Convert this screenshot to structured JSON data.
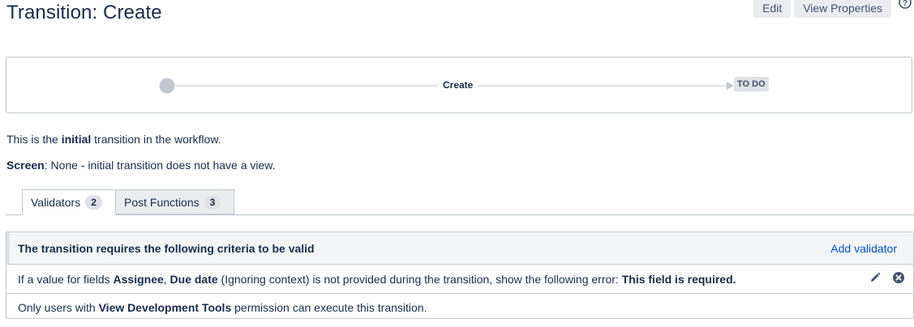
{
  "page": {
    "title": "Transition: Create"
  },
  "toolbar": {
    "edit_label": "Edit",
    "view_properties_label": "View Properties",
    "help_icon": "help-icon"
  },
  "diagram": {
    "transition_name": "Create",
    "target_status": "TO DO"
  },
  "info": {
    "line1": {
      "prefix": "This is the ",
      "bold": "initial",
      "suffix": " transition in the workflow."
    },
    "line2": {
      "label": "Screen",
      "text": ": None - initial transition does not have a view."
    }
  },
  "tabs": [
    {
      "label": "Validators",
      "count": "2",
      "active": true
    },
    {
      "label": "Post Functions",
      "count": "3",
      "active": false
    }
  ],
  "validators": {
    "header": "The transition requires the following criteria to be valid",
    "add_label": "Add validator",
    "rows": [
      {
        "t1": "If a value for fields ",
        "b1": "Assignee",
        "t2": ", ",
        "b2": "Due date",
        "t3": " (Ignoring context) is not provided during the transition, show the following error: ",
        "b3": "This field is required."
      },
      {
        "t1": "Only users with ",
        "b1": "View Development Tools",
        "t2": " permission can execute this transition."
      }
    ]
  },
  "colors": {
    "text": "#172b4d",
    "link": "#0052cc",
    "border": "#c1c7d0",
    "button_bg": "#ebecf0",
    "lozenge_bg": "#dfe1e6"
  }
}
